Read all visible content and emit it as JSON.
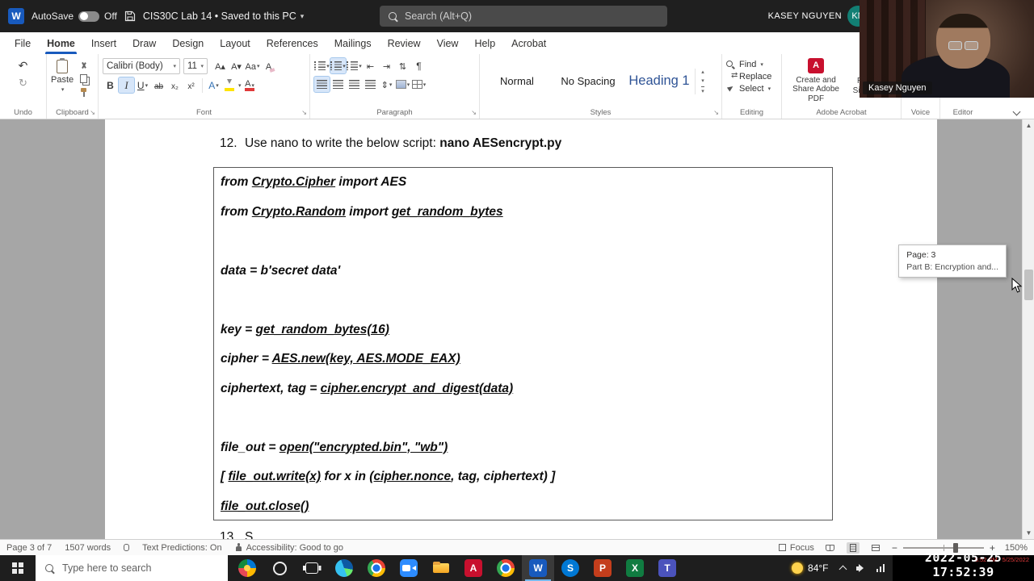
{
  "titlebar": {
    "autosave_label": "AutoSave",
    "autosave_state": "Off",
    "title": "CIS30C Lab 14 • Saved to this PC",
    "search_placeholder": "Search (Alt+Q)",
    "user_name": "KASEY NGUYEN",
    "avatar_initials": "KN"
  },
  "ribbon": {
    "tabs": [
      "File",
      "Home",
      "Insert",
      "Draw",
      "Design",
      "Layout",
      "References",
      "Mailings",
      "Review",
      "View",
      "Help",
      "Acrobat"
    ],
    "active_tab": "Home",
    "font_name": "Calibri (Body)",
    "font_size": "11",
    "paste_label": "Paste",
    "styles": [
      "Normal",
      "No Spacing",
      "Heading 1"
    ],
    "editing": [
      "Find",
      "Replace",
      "Select"
    ],
    "acrobat_buttons": [
      "Create and Share Adobe PDF",
      "Request Signatures"
    ],
    "group_labels": [
      "Undo",
      "Clipboard",
      "Font",
      "Paragraph",
      "Styles",
      "Editing",
      "Adobe Acrobat",
      "Voice",
      "Editor"
    ]
  },
  "document": {
    "item12_number": "12.",
    "item12_text": "Use nano to write the below script: ",
    "item12_command": "nano AESencrypt.py",
    "code_lines": [
      [
        {
          "t": "from ",
          "u": 0
        },
        {
          "t": "Crypto.Cipher",
          "u": 1
        },
        {
          "t": " import AES",
          "u": 0
        }
      ],
      [
        {
          "t": "from ",
          "u": 0
        },
        {
          "t": "Crypto.Random",
          "u": 1
        },
        {
          "t": " import ",
          "u": 0
        },
        {
          "t": "get_random_bytes",
          "u": 1
        }
      ],
      [],
      [
        {
          "t": "data = b'secret data'",
          "u": 0
        }
      ],
      [],
      [
        {
          "t": "key = ",
          "u": 0
        },
        {
          "t": "get_random_bytes(16)",
          "u": 1
        }
      ],
      [
        {
          "t": "cipher = ",
          "u": 0
        },
        {
          "t": "AES.new(key, AES.MODE_EAX)",
          "u": 1
        }
      ],
      [
        {
          "t": "ciphertext, tag = ",
          "u": 0
        },
        {
          "t": "cipher.encrypt_and_digest(data)",
          "u": 1
        }
      ],
      [],
      [
        {
          "t": "file_out = ",
          "u": 0
        },
        {
          "t": "open(\"encrypted.bin\", \"wb\")",
          "u": 1
        }
      ],
      [
        {
          "t": "[ ",
          "u": 0
        },
        {
          "t": "file_out.write(x)",
          "u": 1
        },
        {
          "t": " for x in (",
          "u": 0
        },
        {
          "t": "cipher.nonce",
          "u": 1
        },
        {
          "t": ", tag, ciphertext) ]",
          "u": 0
        }
      ],
      [
        {
          "t": "file_out.close()",
          "u": 1
        }
      ]
    ],
    "item13_number": "13.",
    "item13_fragment": "S"
  },
  "scrollbar_tooltip": {
    "line1": "Page: 3",
    "line2": "Part B: Encryption and..."
  },
  "statusbar": {
    "page_info": "Page 3 of 7",
    "word_count": "1507 words",
    "text_predictions": "Text Predictions: On",
    "accessibility": "Accessibility: Good to go",
    "focus_label": "Focus",
    "zoom_level": "150%"
  },
  "webcam": {
    "participant_name": "Kasey Nguyen"
  },
  "taskbar": {
    "search_placeholder": "Type here to search",
    "app_icons": [
      "widgets",
      "cortana",
      "task-view",
      "edge",
      "chrome",
      "zoom",
      "explorer",
      "acrobat",
      "chrome-2",
      "word",
      "skype",
      "powerpoint",
      "excel",
      "teams"
    ],
    "temperature": "84°F",
    "clock_small_time": "5:52 PM",
    "clock_small_date": "5/25/2022",
    "timestamp_overlay": "2022-05-25 17:52:39"
  }
}
